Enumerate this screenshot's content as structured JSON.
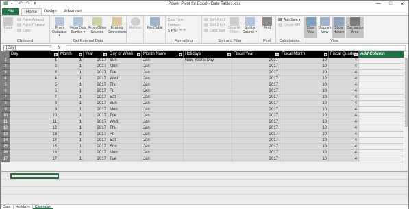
{
  "window": {
    "title": "Power Pivot for Excel - Date Tables.xlsx",
    "controls": [
      "—",
      "□",
      "✕"
    ]
  },
  "tabs": [
    "File",
    "Home",
    "Design",
    "Advanced"
  ],
  "ribbon": {
    "clipboard": {
      "label": "Clipboard",
      "paste": "Paste",
      "paste_append": "Paste Append",
      "paste_replace": "Paste Replace",
      "copy": "Copy"
    },
    "external": {
      "label": "Get External Data",
      "from_database": "From Database ▾",
      "from_data_service": "From Data Service ▾",
      "from_other_sources": "From Other Sources",
      "existing_connections": "Existing Connections"
    },
    "refresh": "Refresh",
    "pivottable": "PivotTable",
    "formatting": {
      "label": "Formatting",
      "data_type": "Data Type :",
      "format": "Format :",
      "symbols": "$ ▾ % ⁾ ⁰⁰ ⁰⁰"
    },
    "sort": {
      "label": "Sort and Filter",
      "sort_az": "Sort A to Z",
      "sort_za": "Sort Z to A",
      "clear_sort": "Clear Sort",
      "clear_all_filters": "Clear All Filters",
      "sort_by_column": "Sort by Column ▾"
    },
    "find": {
      "label": "Find",
      "find": "Find"
    },
    "calculations": {
      "label": "Calculations",
      "autosum": "AutoSum ▾",
      "create_kpi": "Create KPI"
    },
    "view": {
      "label": "View",
      "data_view": "Data View",
      "diagram_view": "Diagram View",
      "show_hidden": "Show Hidden",
      "calculation_area": "Calculation Area"
    }
  },
  "formula_bar": {
    "name_box": "[Day]",
    "fx": "fx"
  },
  "table": {
    "columns": [
      "Day",
      "Month",
      "Year",
      "Day of Week",
      "Month Name",
      "Holidays",
      "Fiscal Year",
      "Fiscal Month",
      "Fiscal Quarter",
      "Add Column"
    ],
    "rows": [
      [
        "1",
        "1",
        "1",
        "2017",
        "Sun",
        "Jan",
        "New Year's Day",
        "2017",
        "10",
        "4"
      ],
      [
        "2",
        "2",
        "1",
        "2017",
        "Mon",
        "Jan",
        "",
        "2017",
        "10",
        "4"
      ],
      [
        "3",
        "3",
        "1",
        "2017",
        "Tue",
        "Jan",
        "",
        "2017",
        "10",
        "4"
      ],
      [
        "4",
        "4",
        "1",
        "2017",
        "Wed",
        "Jan",
        "",
        "2017",
        "10",
        "4"
      ],
      [
        "5",
        "5",
        "1",
        "2017",
        "Thu",
        "Jan",
        "",
        "2017",
        "10",
        "4"
      ],
      [
        "6",
        "6",
        "1",
        "2017",
        "Fri",
        "Jan",
        "",
        "2017",
        "10",
        "4"
      ],
      [
        "7",
        "7",
        "1",
        "2017",
        "Sat",
        "Jan",
        "",
        "2017",
        "10",
        "4"
      ],
      [
        "8",
        "8",
        "1",
        "2017",
        "Sun",
        "Jan",
        "",
        "2017",
        "10",
        "4"
      ],
      [
        "9",
        "9",
        "1",
        "2017",
        "Mon",
        "Jan",
        "",
        "2017",
        "10",
        "4"
      ],
      [
        "10",
        "10",
        "1",
        "2017",
        "Tue",
        "Jan",
        "",
        "2017",
        "10",
        "4"
      ],
      [
        "11",
        "11",
        "1",
        "2017",
        "Wed",
        "Jan",
        "",
        "2017",
        "10",
        "4"
      ],
      [
        "12",
        "12",
        "1",
        "2017",
        "Thu",
        "Jan",
        "",
        "2017",
        "10",
        "4"
      ],
      [
        "13",
        "13",
        "1",
        "2017",
        "Fri",
        "Jan",
        "",
        "2017",
        "10",
        "4"
      ],
      [
        "14",
        "14",
        "1",
        "2017",
        "Sat",
        "Jan",
        "",
        "2017",
        "10",
        "4"
      ],
      [
        "15",
        "15",
        "1",
        "2017",
        "Sun",
        "Jan",
        "",
        "2017",
        "10",
        "4"
      ],
      [
        "16",
        "16",
        "1",
        "2017",
        "Mon",
        "Jan",
        "",
        "2017",
        "10",
        "4"
      ],
      [
        "17",
        "17",
        "1",
        "2017",
        "Tue",
        "Jan",
        "",
        "2017",
        "10",
        "4"
      ]
    ]
  },
  "sheet_tabs": [
    "Date",
    "Holidays",
    "Calendar"
  ],
  "colors": {
    "accent": "#217346",
    "header_bg": "#000000",
    "cell_bg": "#d9d9d9"
  }
}
